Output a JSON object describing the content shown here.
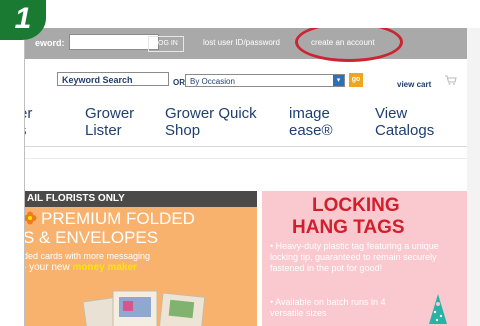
{
  "step_badge": "1",
  "login_bar": {
    "username_label": "eword:",
    "login_button": "LOG IN",
    "lost_link": "lost user ID/password",
    "create_link": "create an account"
  },
  "search": {
    "keyword_value": "Keyword Search",
    "or_label": "OR",
    "occasion_selected": "By Occasion",
    "go_label": "go",
    "view_cart": "view cart"
  },
  "nav": {
    "items": [
      {
        "line1": "er",
        "line2": "s"
      },
      {
        "line1": "Grower",
        "line2": "Lister"
      },
      {
        "line1": "Grower Quick",
        "line2": "Shop"
      },
      {
        "line1": "image",
        "line2": "ease®"
      },
      {
        "line1": "View",
        "line2": "Catalogs"
      }
    ]
  },
  "florists_banner": {
    "strip": "AIL FLORISTS ONLY",
    "title_line1": "PREMIUM FOLDED",
    "title_line2": "S & ENVELOPES",
    "line3": "ded cards with more messaging",
    "line4_prefix": "- your new",
    "line4_highlight": "money maker"
  },
  "tags_banner": {
    "title_line1": "LOCKING",
    "title_line2": "HANG TAGS",
    "bullet1": "• Heavy-duty plastic tag featuring a unique locking tip, guaranteed to remain securely fastened in the pot for good!",
    "bullet2": "• Available on batch runs in 4 versatile sizes"
  },
  "colors": {
    "highlight": "#cc2431",
    "nav_text": "#1f3f6e",
    "login_bar": "#a9a9a9",
    "badge": "#1a7a32",
    "tags_title": "#d11f2b",
    "money_maker": "#fbe500"
  }
}
